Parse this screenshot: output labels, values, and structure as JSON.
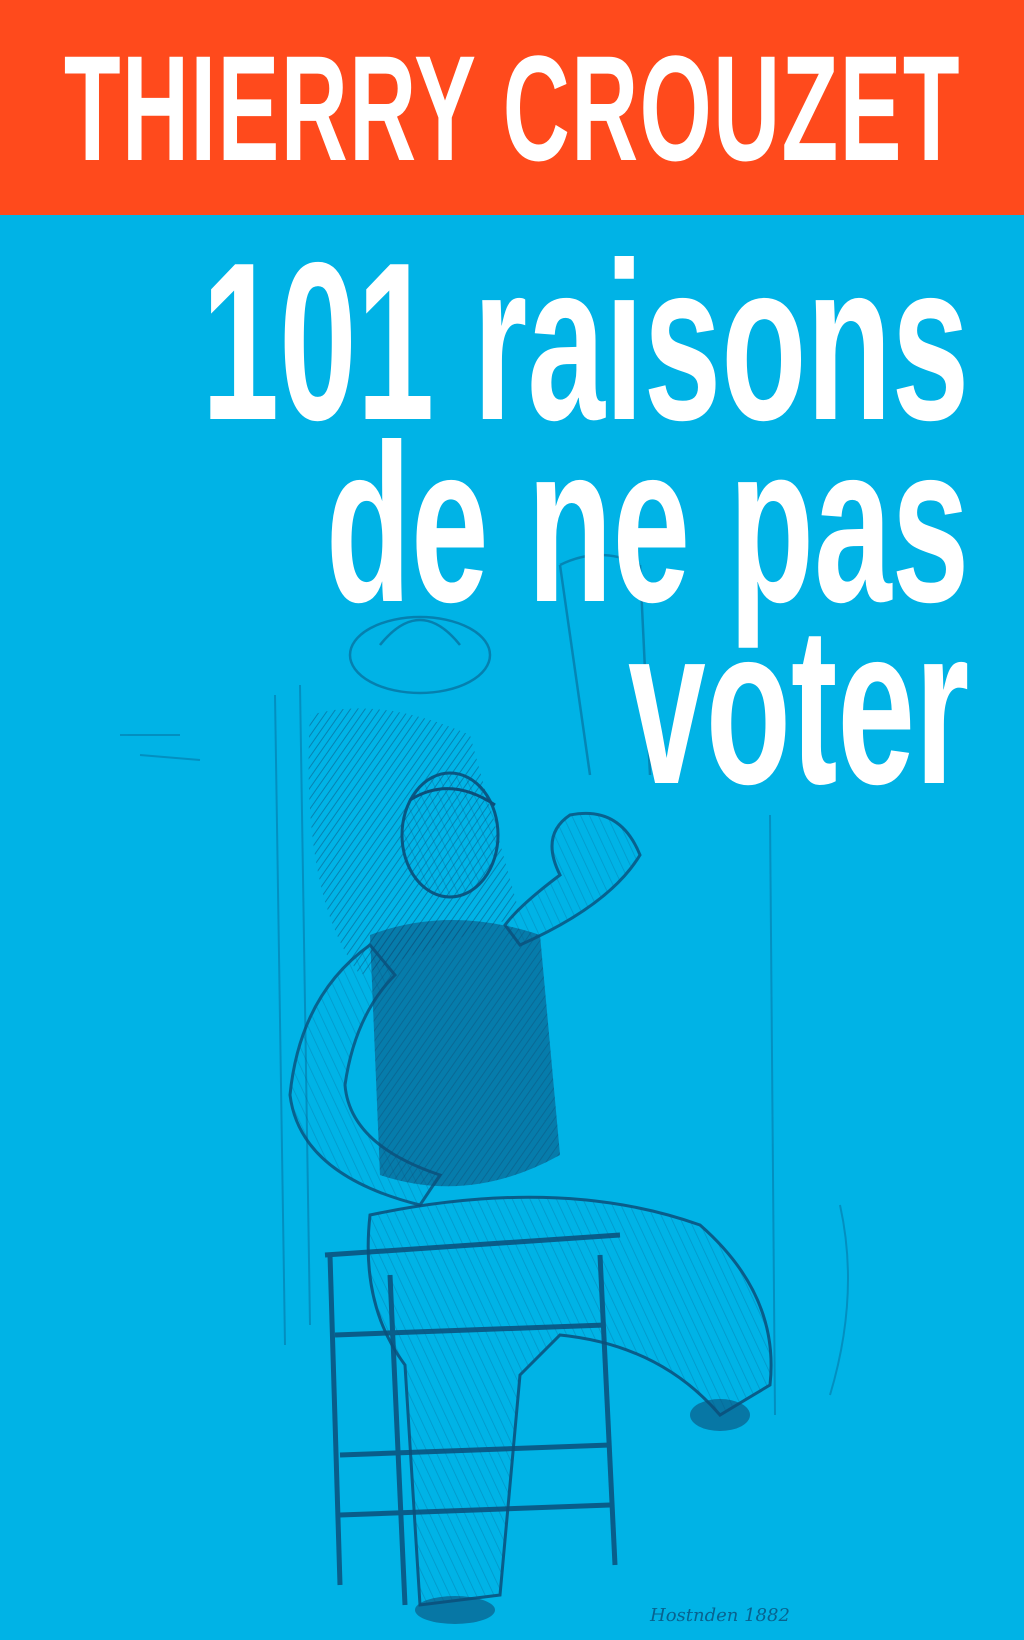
{
  "author": "THIERRY CROUZET",
  "title_lines": [
    "101 raisons",
    "de ne pas",
    "voter"
  ],
  "signature": "Hostnden 1882",
  "colors": {
    "band": "#ff4a1c",
    "background": "#00b3e6",
    "text": "#ffffff",
    "ink": "#0b4f7a"
  },
  "illustration": "engraving-seated-man-on-chair"
}
